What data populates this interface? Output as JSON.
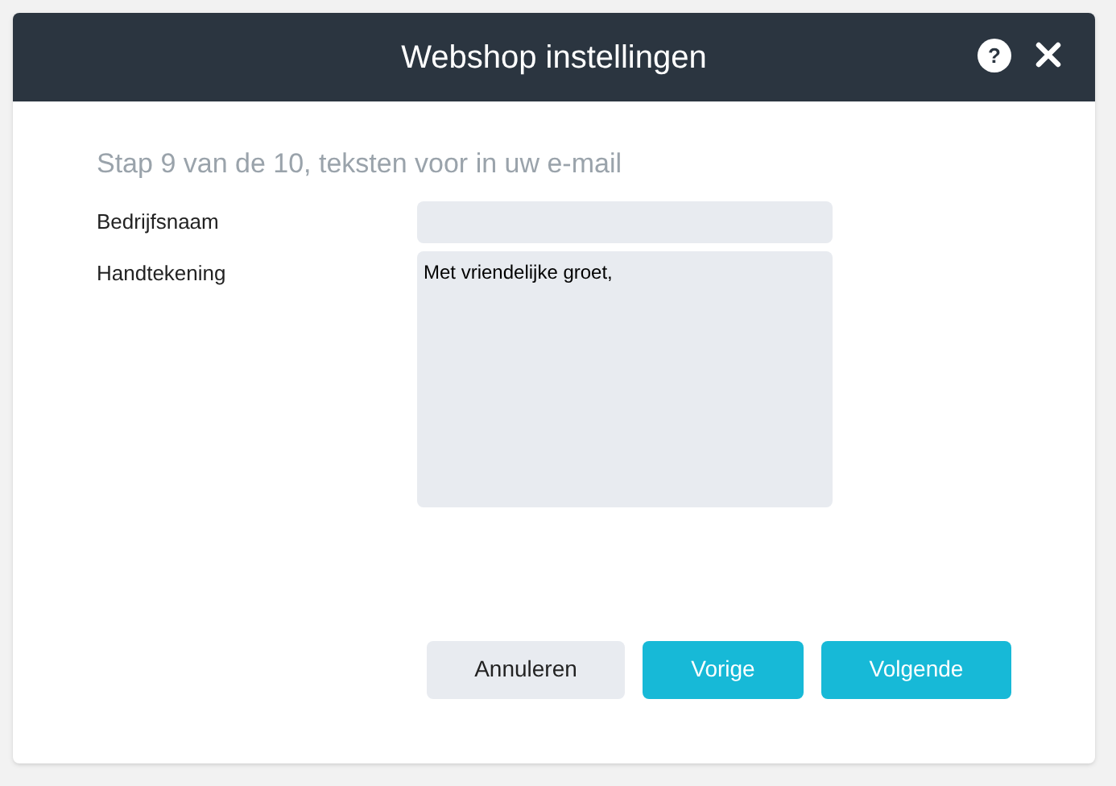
{
  "window": {
    "title": "Webshop instellingen",
    "help": "?"
  },
  "step_title": "Stap 9 van de 10, teksten voor in uw e-mail",
  "fields": [
    {
      "kind": "input",
      "label": "Bedrijfsnaam"
    },
    {
      "kind": "textarea",
      "label": "Handtekening",
      "value": "Met vriendelijke groet,\n"
    }
  ],
  "buttons": [
    {
      "label": "Annuleren",
      "kind": "secondary"
    },
    {
      "label": "Vorige",
      "kind": "primary"
    },
    {
      "label": "Volgende",
      "kind": "primary"
    }
  ]
}
